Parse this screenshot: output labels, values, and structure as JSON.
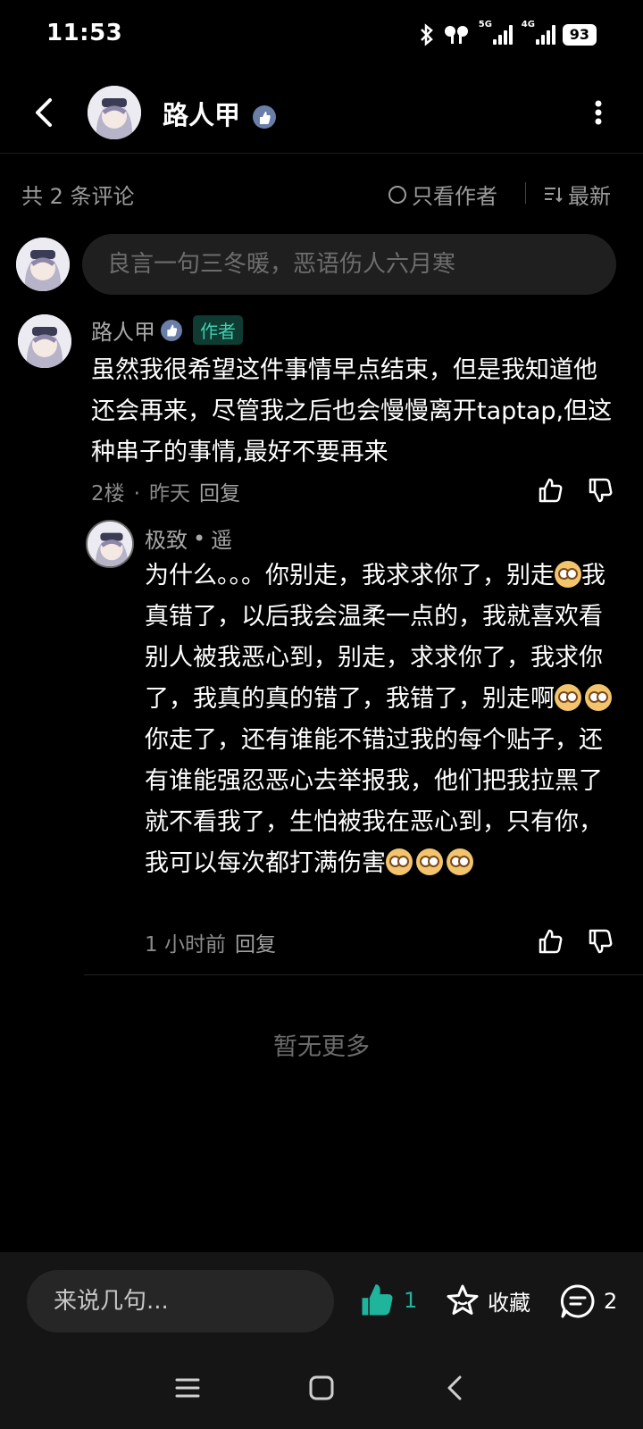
{
  "status_bar": {
    "time": "11:53",
    "battery": "93",
    "network_1": "5G",
    "network_2": "4G"
  },
  "header": {
    "title": "路人甲"
  },
  "comments_header": {
    "count": "共 2 条评论",
    "author_only": "只看作者",
    "sort": "最新"
  },
  "input": {
    "placeholder": "良言一句三冬暖，恶语伤人六月寒"
  },
  "comment": {
    "author": "路人甲",
    "author_tag": "作者",
    "text": "虽然我很希望这件事情早点结束，但是我知道他还会再来，尽管我之后也会慢慢离开taptap,但这种串子的事情,最好不要再来",
    "floor": "2楼",
    "dot": "·",
    "time": "昨天",
    "reply": "回复"
  },
  "reply": {
    "author": "极致",
    "bullet": "•",
    "target": "遥",
    "text_1": "为什么。。。你别走，我求求你了，别走",
    "text_2": "我真错了，以后我会温柔一点的，我就喜欢看别人被我恶心到，别走，求求你了，我求你了，我真的真的错了，我错了，别走啊",
    "text_3": "你走了，还有谁能不错过我的每个贴子，还有谁能强忍恶心去举报我，他们把我拉黑了就不看我了，生怕被我在恶心到，只有你，我可以每次都打满伤害",
    "time": "1 小时前",
    "reply": "回复"
  },
  "no_more": "暂无更多",
  "bottom": {
    "input_placeholder": "来说几句...",
    "like_count": "1",
    "favorite": "收藏",
    "comment_count": "2"
  },
  "colors": {
    "accent": "#3fcfb0",
    "like": "#1fb59c",
    "background": "#000000"
  },
  "icons": [
    "back-icon",
    "verified-badge-icon",
    "more-icon",
    "circle-icon",
    "sort-icon",
    "thumb-up-icon",
    "thumb-down-icon",
    "star-icon",
    "comment-icon",
    "menu-icon",
    "home-icon",
    "back-nav-icon"
  ]
}
